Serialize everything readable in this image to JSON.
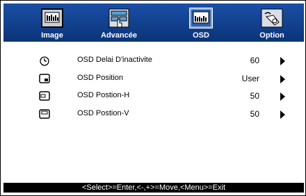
{
  "tabs": [
    {
      "label": "Image",
      "icon": "monitor-image-icon"
    },
    {
      "label": "Advancée",
      "icon": "advanced-hand-icon"
    },
    {
      "label": "OSD",
      "icon": "osd-window-icon"
    },
    {
      "label": "Option",
      "icon": "option-hand-icon"
    }
  ],
  "active_tab": "OSD",
  "items": [
    {
      "label": "OSD Delai D'inactivite",
      "value": "60",
      "icon": "timer-icon"
    },
    {
      "label": "OSD Position",
      "value": "User",
      "icon": "position-icon"
    },
    {
      "label": "OSD Postion-H",
      "value": "50",
      "icon": "horizontal-position-icon"
    },
    {
      "label": "OSD Postion-V",
      "value": "50",
      "icon": "vertical-position-icon"
    }
  ],
  "footer": "<Select>=Enter,<-,+>=Move,<Menu>=Exit",
  "colors": {
    "tabbar": "#0d3a85",
    "footer_bg": "#000000"
  }
}
